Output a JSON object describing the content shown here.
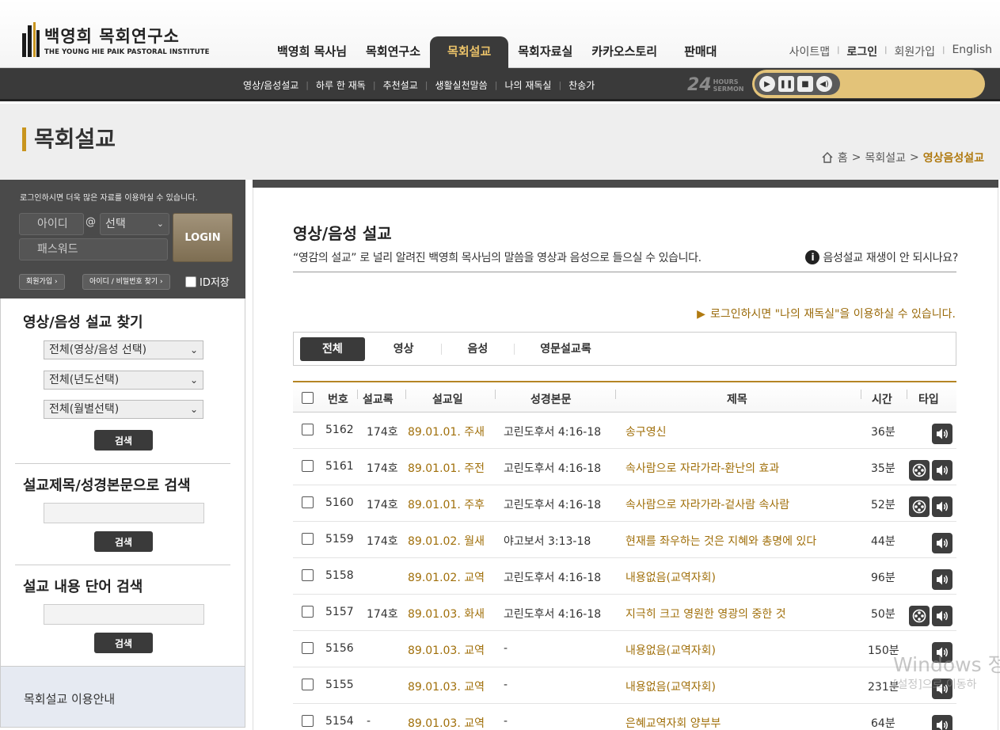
{
  "logo": {
    "ko": "백영희 목회연구소",
    "en": "THE YOUNG HIE PAIK PASTORAL INSTITUTE"
  },
  "gnb": [
    "백영희 목사님",
    "목회연구소",
    "목회설교",
    "목회자료실",
    "카카오스토리",
    "판매대"
  ],
  "util": {
    "sitemap": "사이트맵",
    "login": "로그인",
    "join": "회원가입",
    "english": "English"
  },
  "subnav": [
    "영상/음성설교",
    "하루 한 재독",
    "추천설교",
    "생활실천말씀",
    "나의 재독실",
    "찬송가"
  ],
  "hours24": {
    "num": "24",
    "l1": "HOURS",
    "l2": "SERMON"
  },
  "page_title": "목회설교",
  "breadcrumb": {
    "home": "홈",
    "c1": "목회설교",
    "current": "영상음성설교"
  },
  "login": {
    "message": "로그인하시면 더욱 많은 자료를 이용하실 수 있습니다.",
    "id_placeholder": "아이디",
    "at": "@",
    "domain_select": "선택",
    "pw_placeholder": "패스워드",
    "login_button": "LOGIN",
    "join_button": "회원가입",
    "find_button": "아이디 / 비밀번호 찾기",
    "id_save": "ID저장"
  },
  "search1": {
    "title": "영상/음성 설교 찾기",
    "type_select": "전체(영상/음성 선택)",
    "year_select": "전체(년도선택)",
    "month_select": "전체(월별선택)",
    "button": "검색"
  },
  "search2": {
    "title": "설교제목/성경본문으로 검색",
    "button": "검색"
  },
  "search3": {
    "title": "설교 내용 단어 검색",
    "button": "검색"
  },
  "guide": "목회설교 이용안내",
  "main": {
    "heading": "영상/음성 설교",
    "description": "“영감의 설교” 로 널리 알려진 백영희 목사님의 말씀을 영상과 음성으로 들으실 수 있습니다.",
    "help": "음성설교 재생이 안 되시나요?",
    "notice": "로그인하시면 \"나의 재독실\"을 이용하실 수 있습니다.",
    "tabs": [
      "전체",
      "영상",
      "음성",
      "영문설교록"
    ]
  },
  "table": {
    "headers": [
      "번호",
      "설교록",
      "설교일",
      "성경본문",
      "제목",
      "시간",
      "타입"
    ],
    "rows": [
      {
        "no": "5162",
        "book": "174호",
        "date": "89.01.01. 주새",
        "text": "고린도후서 4:16-18",
        "title": "송구영신",
        "time": "36분",
        "video": false
      },
      {
        "no": "5161",
        "book": "174호",
        "date": "89.01.01. 주전",
        "text": "고린도후서 4:16-18",
        "title": "속사람으로 자라가라-환난의 효과",
        "time": "35분",
        "video": true
      },
      {
        "no": "5160",
        "book": "174호",
        "date": "89.01.01. 주후",
        "text": "고린도후서 4:16-18",
        "title": "속사람으로 자라가라-겉사람 속사람",
        "time": "52분",
        "video": true
      },
      {
        "no": "5159",
        "book": "174호",
        "date": "89.01.02. 월새",
        "text": "야고보서 3:13-18",
        "title": "현재를 좌우하는 것은 지혜와 총명에 있다",
        "time": "44분",
        "video": false
      },
      {
        "no": "5158",
        "book": "",
        "date": "89.01.02. 교역",
        "text": "고린도후서 4:16-18",
        "title": "내용없음(교역자회)",
        "time": "96분",
        "video": false
      },
      {
        "no": "5157",
        "book": "174호",
        "date": "89.01.03. 화새",
        "text": "고린도후서 4:16-18",
        "title": "지극히 크고 영원한 영광의 중한 것",
        "time": "50분",
        "video": true
      },
      {
        "no": "5156",
        "book": "",
        "date": "89.01.03. 교역",
        "text": "-",
        "title": "내용없음(교역자회)",
        "time": "150분",
        "video": false
      },
      {
        "no": "5155",
        "book": "",
        "date": "89.01.03. 교역",
        "text": "-",
        "title": "내용없음(교역자회)",
        "time": "231분",
        "video": false
      },
      {
        "no": "5154",
        "book": "-",
        "date": "89.01.03. 교역",
        "text": "-",
        "title": "은혜교역자회 양부부",
        "time": "64분",
        "video": false
      }
    ]
  },
  "watermark": {
    "line1": "Windows 정",
    "line2": "[설정]으로 이동하"
  }
}
